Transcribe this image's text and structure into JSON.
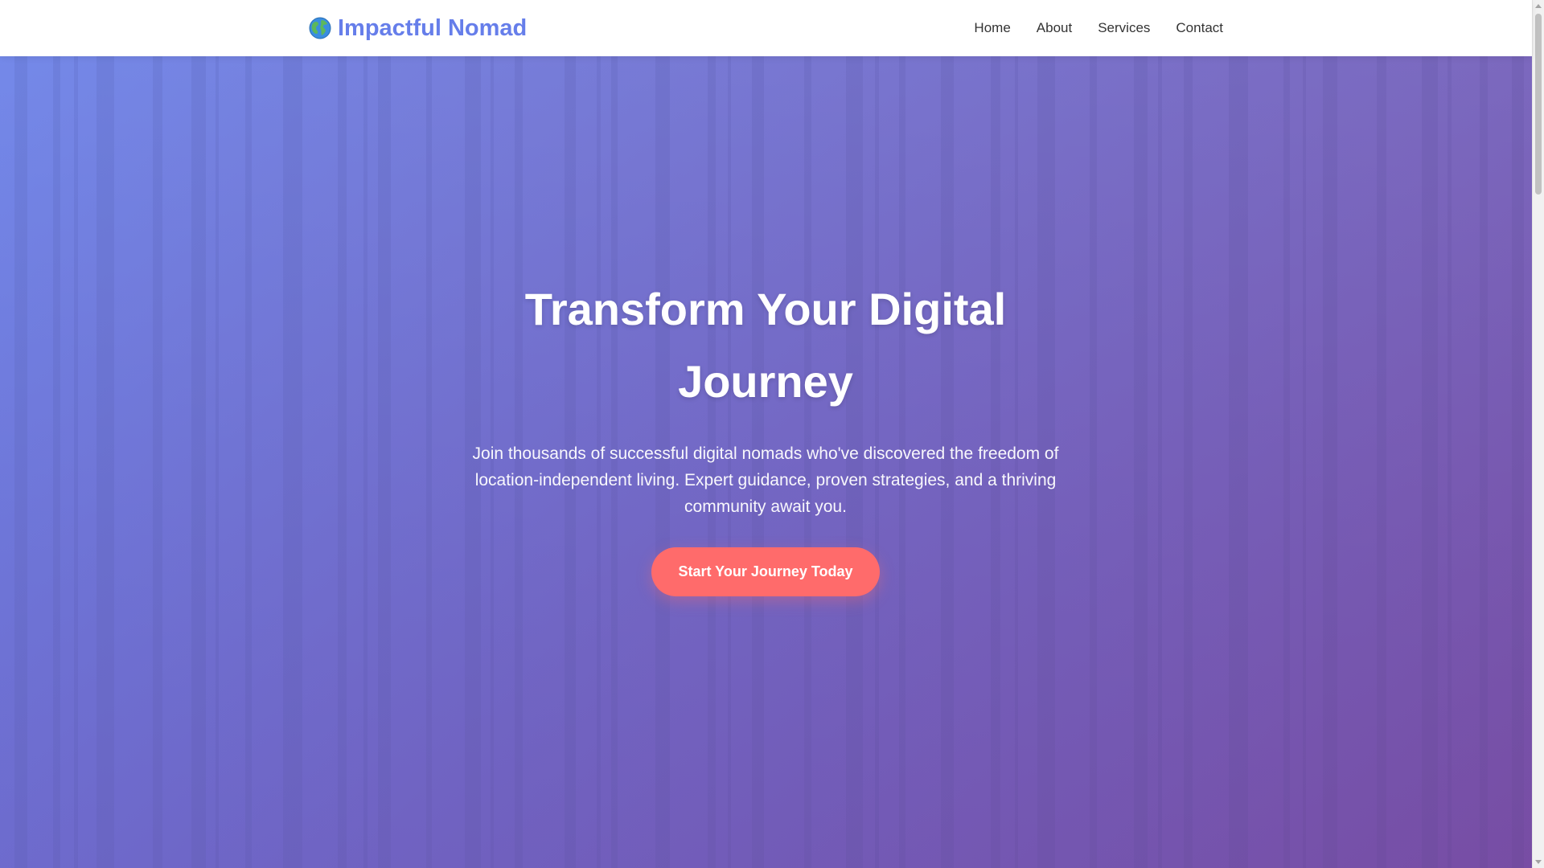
{
  "brand": {
    "name": "Impactful Nomad",
    "icon": "globe-icon",
    "color": "#667eea"
  },
  "nav": {
    "items": [
      {
        "label": "Home"
      },
      {
        "label": "About"
      },
      {
        "label": "Services"
      },
      {
        "label": "Contact"
      }
    ]
  },
  "hero": {
    "title": "Transform Your Digital Journey",
    "subtitle": "Join thousands of successful digital nomads who've discovered the freedom of location-independent living. Expert guidance, proven strategies, and a thriving community await you.",
    "cta_label": "Start Your Journey Today",
    "cta_color": "#ff6b6b",
    "overlay_start": "#667eea",
    "overlay_end": "#764ba2"
  },
  "scrollbar": {
    "position": 0
  }
}
